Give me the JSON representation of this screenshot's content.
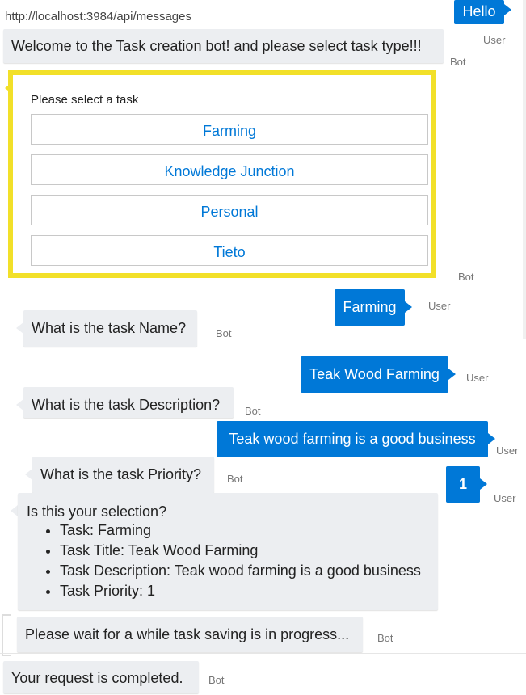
{
  "url": "http://localhost:3984/api/messages",
  "messages": {
    "m1": {
      "text": "Hello",
      "sender": "User"
    },
    "m2": {
      "text": "Welcome to the Task creation bot! and please select task type!!!",
      "sender": "Bot"
    },
    "card": {
      "title": "Please select a task",
      "options": [
        "Farming",
        "Knowledge Junction",
        "Personal",
        "Tieto"
      ],
      "sender": "Bot"
    },
    "m3": {
      "text": "Farming",
      "sender": "User"
    },
    "m4": {
      "text": "What is the task Name?",
      "sender": "Bot"
    },
    "m5": {
      "text": "Teak Wood Farming",
      "sender": "User"
    },
    "m6": {
      "text": "What is the task Description?",
      "sender": "Bot"
    },
    "m7": {
      "text": "Teak wood farming is a good business",
      "sender": "User"
    },
    "m8": {
      "text": "What is the task Priority?",
      "sender": "Bot"
    },
    "m9": {
      "text": "1",
      "sender": "User"
    },
    "m10": {
      "heading": "Is this your selection?",
      "items": [
        "Task: Farming",
        "Task Title: Teak Wood Farming",
        "Task Description: Teak wood farming is a good business",
        "Task Priority: 1"
      ]
    },
    "m11": {
      "text": "Please wait for a while task saving is in progress...",
      "sender": "Bot"
    },
    "m12": {
      "text": "Your request is completed.",
      "sender": "Bot"
    }
  },
  "colors": {
    "user_bubble": "#0078d7",
    "bot_bubble": "#eceef1",
    "highlight": "#f2e029"
  }
}
